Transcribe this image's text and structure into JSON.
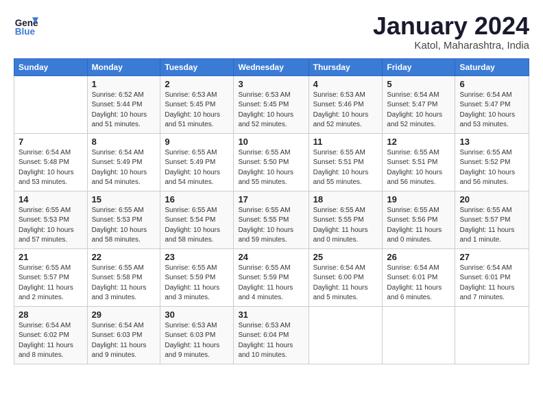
{
  "logo": {
    "line1": "General",
    "line2": "Blue"
  },
  "title": "January 2024",
  "location": "Katol, Maharashtra, India",
  "header": {
    "days": [
      "Sunday",
      "Monday",
      "Tuesday",
      "Wednesday",
      "Thursday",
      "Friday",
      "Saturday"
    ]
  },
  "weeks": [
    [
      {
        "num": "",
        "info": ""
      },
      {
        "num": "1",
        "info": "Sunrise: 6:52 AM\nSunset: 5:44 PM\nDaylight: 10 hours\nand 51 minutes."
      },
      {
        "num": "2",
        "info": "Sunrise: 6:53 AM\nSunset: 5:45 PM\nDaylight: 10 hours\nand 51 minutes."
      },
      {
        "num": "3",
        "info": "Sunrise: 6:53 AM\nSunset: 5:45 PM\nDaylight: 10 hours\nand 52 minutes."
      },
      {
        "num": "4",
        "info": "Sunrise: 6:53 AM\nSunset: 5:46 PM\nDaylight: 10 hours\nand 52 minutes."
      },
      {
        "num": "5",
        "info": "Sunrise: 6:54 AM\nSunset: 5:47 PM\nDaylight: 10 hours\nand 52 minutes."
      },
      {
        "num": "6",
        "info": "Sunrise: 6:54 AM\nSunset: 5:47 PM\nDaylight: 10 hours\nand 53 minutes."
      }
    ],
    [
      {
        "num": "7",
        "info": "Sunrise: 6:54 AM\nSunset: 5:48 PM\nDaylight: 10 hours\nand 53 minutes."
      },
      {
        "num": "8",
        "info": "Sunrise: 6:54 AM\nSunset: 5:49 PM\nDaylight: 10 hours\nand 54 minutes."
      },
      {
        "num": "9",
        "info": "Sunrise: 6:55 AM\nSunset: 5:49 PM\nDaylight: 10 hours\nand 54 minutes."
      },
      {
        "num": "10",
        "info": "Sunrise: 6:55 AM\nSunset: 5:50 PM\nDaylight: 10 hours\nand 55 minutes."
      },
      {
        "num": "11",
        "info": "Sunrise: 6:55 AM\nSunset: 5:51 PM\nDaylight: 10 hours\nand 55 minutes."
      },
      {
        "num": "12",
        "info": "Sunrise: 6:55 AM\nSunset: 5:51 PM\nDaylight: 10 hours\nand 56 minutes."
      },
      {
        "num": "13",
        "info": "Sunrise: 6:55 AM\nSunset: 5:52 PM\nDaylight: 10 hours\nand 56 minutes."
      }
    ],
    [
      {
        "num": "14",
        "info": "Sunrise: 6:55 AM\nSunset: 5:53 PM\nDaylight: 10 hours\nand 57 minutes."
      },
      {
        "num": "15",
        "info": "Sunrise: 6:55 AM\nSunset: 5:53 PM\nDaylight: 10 hours\nand 58 minutes."
      },
      {
        "num": "16",
        "info": "Sunrise: 6:55 AM\nSunset: 5:54 PM\nDaylight: 10 hours\nand 58 minutes."
      },
      {
        "num": "17",
        "info": "Sunrise: 6:55 AM\nSunset: 5:55 PM\nDaylight: 10 hours\nand 59 minutes."
      },
      {
        "num": "18",
        "info": "Sunrise: 6:55 AM\nSunset: 5:55 PM\nDaylight: 11 hours\nand 0 minutes."
      },
      {
        "num": "19",
        "info": "Sunrise: 6:55 AM\nSunset: 5:56 PM\nDaylight: 11 hours\nand 0 minutes."
      },
      {
        "num": "20",
        "info": "Sunrise: 6:55 AM\nSunset: 5:57 PM\nDaylight: 11 hours\nand 1 minute."
      }
    ],
    [
      {
        "num": "21",
        "info": "Sunrise: 6:55 AM\nSunset: 5:57 PM\nDaylight: 11 hours\nand 2 minutes."
      },
      {
        "num": "22",
        "info": "Sunrise: 6:55 AM\nSunset: 5:58 PM\nDaylight: 11 hours\nand 3 minutes."
      },
      {
        "num": "23",
        "info": "Sunrise: 6:55 AM\nSunset: 5:59 PM\nDaylight: 11 hours\nand 3 minutes."
      },
      {
        "num": "24",
        "info": "Sunrise: 6:55 AM\nSunset: 5:59 PM\nDaylight: 11 hours\nand 4 minutes."
      },
      {
        "num": "25",
        "info": "Sunrise: 6:54 AM\nSunset: 6:00 PM\nDaylight: 11 hours\nand 5 minutes."
      },
      {
        "num": "26",
        "info": "Sunrise: 6:54 AM\nSunset: 6:01 PM\nDaylight: 11 hours\nand 6 minutes."
      },
      {
        "num": "27",
        "info": "Sunrise: 6:54 AM\nSunset: 6:01 PM\nDaylight: 11 hours\nand 7 minutes."
      }
    ],
    [
      {
        "num": "28",
        "info": "Sunrise: 6:54 AM\nSunset: 6:02 PM\nDaylight: 11 hours\nand 8 minutes."
      },
      {
        "num": "29",
        "info": "Sunrise: 6:54 AM\nSunset: 6:03 PM\nDaylight: 11 hours\nand 9 minutes."
      },
      {
        "num": "30",
        "info": "Sunrise: 6:53 AM\nSunset: 6:03 PM\nDaylight: 11 hours\nand 9 minutes."
      },
      {
        "num": "31",
        "info": "Sunrise: 6:53 AM\nSunset: 6:04 PM\nDaylight: 11 hours\nand 10 minutes."
      },
      {
        "num": "",
        "info": ""
      },
      {
        "num": "",
        "info": ""
      },
      {
        "num": "",
        "info": ""
      }
    ]
  ]
}
